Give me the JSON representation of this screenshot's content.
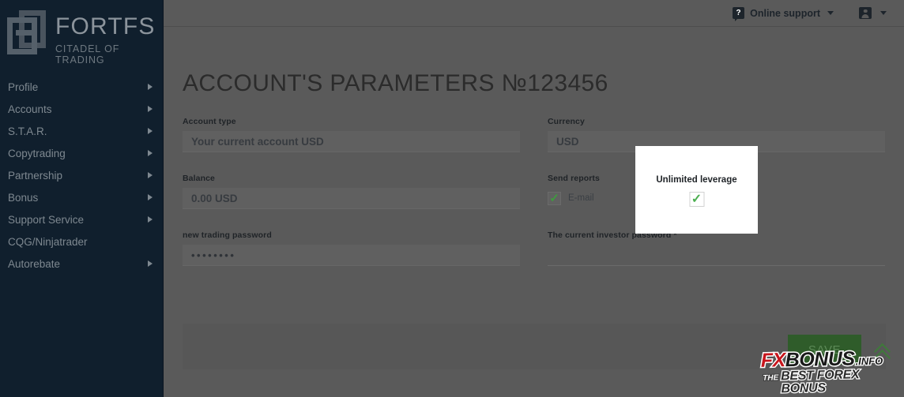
{
  "sidebar": {
    "logo": {
      "title": "FORTFS",
      "subtitle": "CITADEL OF TRADING",
      "icon": "fortfs-logo-icon"
    },
    "items": [
      {
        "label": "Profile",
        "has_arrow": true
      },
      {
        "label": "Accounts",
        "has_arrow": true
      },
      {
        "label": "S.T.A.R.",
        "has_arrow": true
      },
      {
        "label": "Copytrading",
        "has_arrow": true
      },
      {
        "label": "Partnership",
        "has_arrow": true
      },
      {
        "label": "Bonus",
        "has_arrow": true
      },
      {
        "label": "Support Service",
        "has_arrow": true
      },
      {
        "label": "CQG/Ninjatrader",
        "has_arrow": false
      },
      {
        "label": "Autorebate",
        "has_arrow": true
      }
    ]
  },
  "topbar": {
    "support_label": "Online support",
    "support_icon": "question-bubble-icon",
    "support_caret": "chevron-down-icon",
    "user_icon": "user-account-icon",
    "user_caret": "chevron-down-icon",
    "q_glyph": "?"
  },
  "main": {
    "page_title": "ACCOUNT'S PARAMETERS №123456",
    "fields": {
      "account_type": {
        "label": "Account type",
        "value": "Your current account USD"
      },
      "currency": {
        "label": "Currency",
        "value": "USD"
      },
      "balance": {
        "label": "Balance",
        "value": "0.00 USD"
      },
      "send_reports": {
        "label": "Send reports",
        "option_label": "E-mail",
        "checked": true,
        "check_glyph": "✓"
      },
      "new_trading_password": {
        "label": "new trading password",
        "value": "••••••••"
      },
      "current_investor_password": {
        "label": "The current investor password *",
        "value": ""
      }
    },
    "save_label": "SAVE",
    "scroll_top_icon": "double-chevron-up-icon"
  },
  "spotlight": {
    "title": "Unlimited leverage",
    "check_glyph": "✓",
    "checked": true
  },
  "watermark": {
    "fx": "FX",
    "bonus": "BONUS",
    "info": ".INFO",
    "the": "THE",
    "tagline": "BEST FOREX BONUS"
  },
  "colors": {
    "sidebar_bg": "#101f2d",
    "content_bg": "#5a5a5a",
    "accent_green": "#4caf50",
    "save_green": "#2f5c2a",
    "watermark_red": "#c8161d"
  }
}
